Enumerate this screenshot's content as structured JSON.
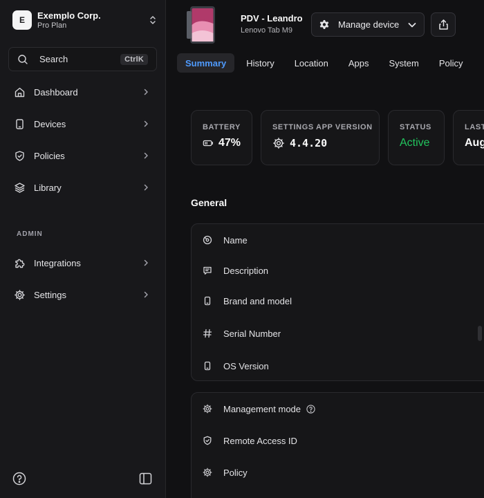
{
  "org": {
    "initial": "E",
    "name": "Exemplo Corp.",
    "plan": "Pro Plan"
  },
  "search": {
    "label": "Search",
    "shortcut": "CtrlK"
  },
  "nav": {
    "items": [
      {
        "label": "Dashboard",
        "icon": "home-icon"
      },
      {
        "label": "Devices",
        "icon": "phone-icon"
      },
      {
        "label": "Policies",
        "icon": "shield-icon"
      },
      {
        "label": "Library",
        "icon": "layers-icon"
      }
    ]
  },
  "admin": {
    "section_label": "ADMIN",
    "items": [
      {
        "label": "Integrations",
        "icon": "puzzle-icon"
      },
      {
        "label": "Settings",
        "icon": "gear-icon"
      }
    ]
  },
  "device": {
    "name": "PDV - Leandro",
    "model": "Lenovo Tab M9"
  },
  "header": {
    "manage_label": "Manage device"
  },
  "tabs": [
    {
      "label": "Summary",
      "active": true
    },
    {
      "label": "History"
    },
    {
      "label": "Location"
    },
    {
      "label": "Apps"
    },
    {
      "label": "System"
    },
    {
      "label": "Policy"
    }
  ],
  "stats": [
    {
      "label": "BATTERY",
      "value": "47%",
      "icon": "battery-icon"
    },
    {
      "label": "SETTINGS APP VERSION",
      "value": "4.4.20",
      "icon": "gear-icon"
    },
    {
      "label": "STATUS",
      "value": "Active",
      "color": "#22c55e"
    },
    {
      "label": "LAST",
      "value": "Aug"
    }
  ],
  "general": {
    "title": "General",
    "rows": [
      {
        "label": "Name",
        "icon": "tag-icon"
      },
      {
        "label": "Description",
        "icon": "comment-icon"
      },
      {
        "label": "Brand and model",
        "icon": "phone-icon"
      },
      {
        "label": "Serial Number",
        "icon": "hash-icon"
      },
      {
        "label": "OS Version",
        "icon": "phone-icon"
      }
    ]
  },
  "management": {
    "rows": [
      {
        "label": "Management mode",
        "icon": "gear-icon",
        "has_help": true
      },
      {
        "label": "Remote Access ID",
        "icon": "shield-check-icon"
      },
      {
        "label": "Policy",
        "icon": "gear-icon"
      }
    ]
  },
  "colors": {
    "accent": "#4f9bff",
    "active_status": "#22c55e",
    "background": "#111113",
    "sidebar": "#18181b"
  }
}
